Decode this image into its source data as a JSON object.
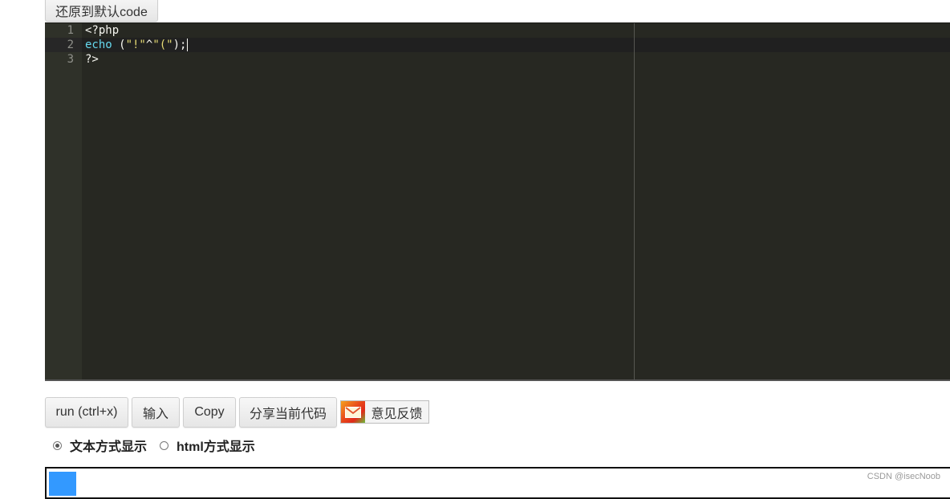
{
  "toolbar_top": {
    "reset_label": "还原到默认code"
  },
  "editor": {
    "lines": [
      {
        "number": "1",
        "tokens": [
          {
            "type": "plain",
            "text": "<?php"
          }
        ]
      },
      {
        "number": "2",
        "tokens": [
          {
            "type": "kw",
            "text": "echo"
          },
          {
            "type": "plain",
            "text": " ("
          },
          {
            "type": "str",
            "text": "\"!\""
          },
          {
            "type": "plain",
            "text": "^"
          },
          {
            "type": "str",
            "text": "\"(\""
          },
          {
            "type": "plain",
            "text": ");"
          }
        ]
      },
      {
        "number": "3",
        "tokens": [
          {
            "type": "plain",
            "text": "?>"
          }
        ]
      }
    ],
    "active_line": 2,
    "colors": {
      "background": "#272822",
      "keyword": "#66d9ef",
      "string": "#e6db74",
      "text": "#f8f8f2"
    }
  },
  "actions": {
    "run_label": "run (ctrl+x)",
    "input_label": "输入",
    "copy_label": "Copy",
    "share_label": "分享当前代码",
    "feedback_label": "意见反馈",
    "feedback_icon": "mail-icon"
  },
  "display_mode": {
    "options": [
      {
        "label": "文本方式显示",
        "checked": true
      },
      {
        "label": "html方式显示",
        "checked": false
      }
    ]
  },
  "output": {
    "accent_color": "#3399ff"
  },
  "watermark": "CSDN @isecNoob"
}
